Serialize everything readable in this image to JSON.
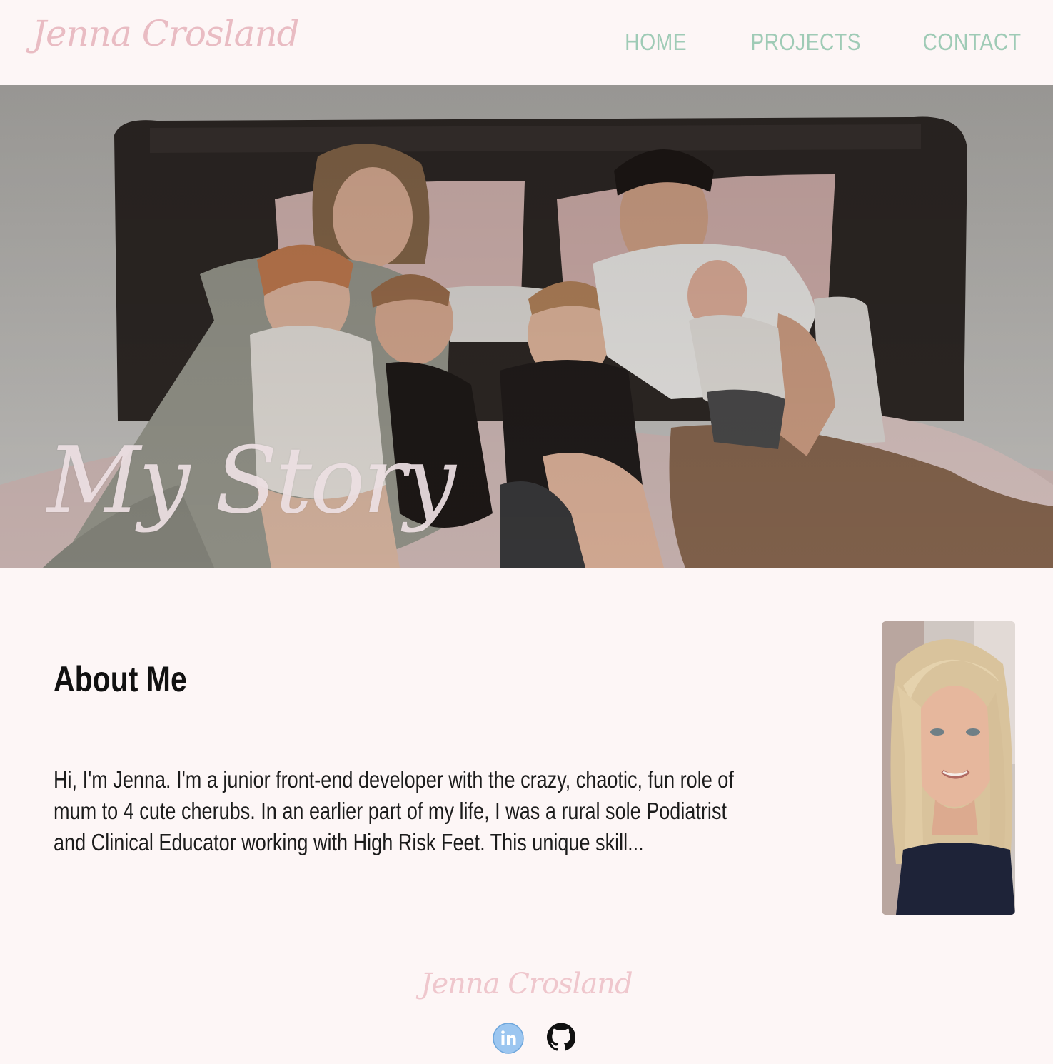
{
  "header": {
    "logo": "Jenna Crosland",
    "nav": [
      {
        "label": "HOME"
      },
      {
        "label": "PROJECTS"
      },
      {
        "label": "CONTACT"
      }
    ]
  },
  "hero": {
    "title": "My Story"
  },
  "about": {
    "heading": "About Me",
    "text": "Hi, I'm Jenna. I'm a junior front-end developer with the crazy, chaotic, fun role of mum to 4 cute cherubs. In an earlier part of my life, I was a rural sole Podiatrist and Clinical Educator working with High Risk Feet. This unique skill..."
  },
  "footer": {
    "logo": "Jenna Crosland",
    "socials": [
      {
        "icon": "linkedin-icon"
      },
      {
        "icon": "github-icon"
      }
    ]
  },
  "colors": {
    "background": "#fdf6f6",
    "logo_pink": "#e9bcc3",
    "nav_green": "#9fcbb6",
    "text": "#1c1c1c"
  }
}
